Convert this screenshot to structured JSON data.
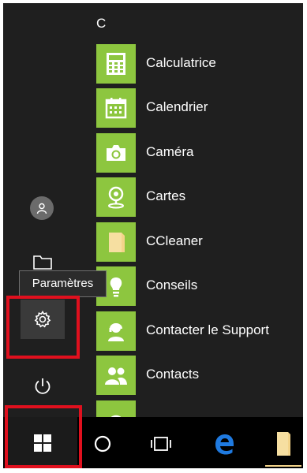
{
  "start_menu": {
    "section_letter": "C",
    "apps": [
      {
        "label": "Calculatrice",
        "icon": "calculator-icon"
      },
      {
        "label": "Calendrier",
        "icon": "calendar-icon"
      },
      {
        "label": "Caméra",
        "icon": "camera-icon"
      },
      {
        "label": "Cartes",
        "icon": "map-pin-icon"
      },
      {
        "label": "CCleaner",
        "icon": "folder-icon"
      },
      {
        "label": "Conseils",
        "icon": "lightbulb-icon"
      },
      {
        "label": "Contacter le Support",
        "icon": "support-person-icon"
      },
      {
        "label": "Contacts",
        "icon": "people-icon"
      }
    ]
  },
  "rail": {
    "user_icon": "user-avatar-icon",
    "documents_icon": "folder-icon",
    "settings_icon": "gear-icon",
    "power_icon": "power-icon",
    "tooltip": "Paramètres"
  },
  "taskbar": {
    "start_icon": "windows-logo-icon",
    "search_icon": "cortana-circle-icon",
    "task_view_icon": "task-view-icon",
    "edge_icon": "edge-icon",
    "explorer_icon": "file-explorer-icon"
  },
  "colors": {
    "tile": "#8dc63f",
    "background": "#1f1f1f",
    "taskbar": "#000000",
    "highlight": "#e0101e",
    "edge_blue": "#1f7ae0",
    "folder_yellow": "#f3d48a"
  }
}
